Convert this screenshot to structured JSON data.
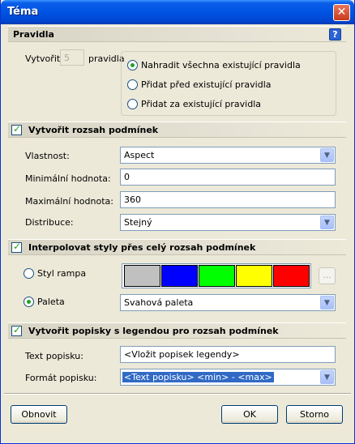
{
  "window": {
    "title": "Téma",
    "close_glyph": "✕"
  },
  "rules": {
    "header": "Pravidla",
    "help_glyph": "?",
    "create_label": "Vytvořit",
    "create_count": "5",
    "rules_suffix": "pravidla",
    "options": [
      {
        "label": "Nahradit všechna existující pravidla",
        "selected": true
      },
      {
        "label": "Přidat před existující pravidla",
        "selected": false
      },
      {
        "label": "Přidat za existující pravidla",
        "selected": false
      }
    ]
  },
  "range": {
    "header": "Vytvořit rozsah podmínek",
    "checked": true,
    "property_label": "Vlastnost:",
    "property_value": "Aspect",
    "min_label": "Minimální hodnota:",
    "min_value": "0",
    "max_label": "Maximální hodnota:",
    "max_value": "360",
    "distribution_label": "Distribuce:",
    "distribution_value": "Stejný"
  },
  "interpolate": {
    "header": "Interpolovat styly přes celý rozsah podmínek",
    "checked": true,
    "ramp_label": "Styl rampa",
    "ramp_selected": false,
    "ramp_colors": [
      "#c0c0c0",
      "#0000ff",
      "#00ff00",
      "#ffff00",
      "#ff0000"
    ],
    "ramp_button": "...",
    "palette_label": "Paleta",
    "palette_selected": true,
    "palette_value": "Svahová paleta"
  },
  "legend": {
    "header": "Vytvořit popisky s legendou pro rozsah podmínek",
    "checked": true,
    "text_label": "Text popisku:",
    "text_value": "<Vložit popisek legendy>",
    "format_label": "Formát popisku:",
    "format_value": "<Text popisku> <min> - <max>"
  },
  "buttons": {
    "refresh": "Obnovit",
    "ok": "OK",
    "cancel": "Storno"
  },
  "icons": {
    "dropdown": "▼"
  }
}
